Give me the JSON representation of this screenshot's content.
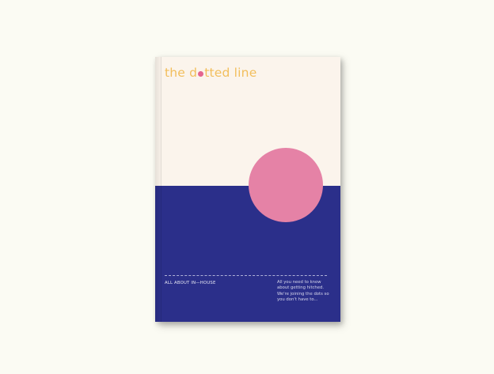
{
  "cover": {
    "title_before_dot": "the d",
    "title_after_dot": "tted line",
    "section_label": "ALL ABOUT IN—HOUSE",
    "blurb_lines": [
      "All you need to know",
      "about getting hitched.",
      "We're joining the dots so",
      "you don't have to..."
    ]
  },
  "colors": {
    "background": "#fbfbf3",
    "paper": "#fbf4ec",
    "title": "#f2be5c",
    "blue_panel": "#2b2f8a",
    "circle": "#e582a6",
    "title_dot": "#e4648f"
  },
  "decor": {
    "title_dot_shape": "small-filled-circle",
    "main_shape": "large-filled-circle"
  }
}
